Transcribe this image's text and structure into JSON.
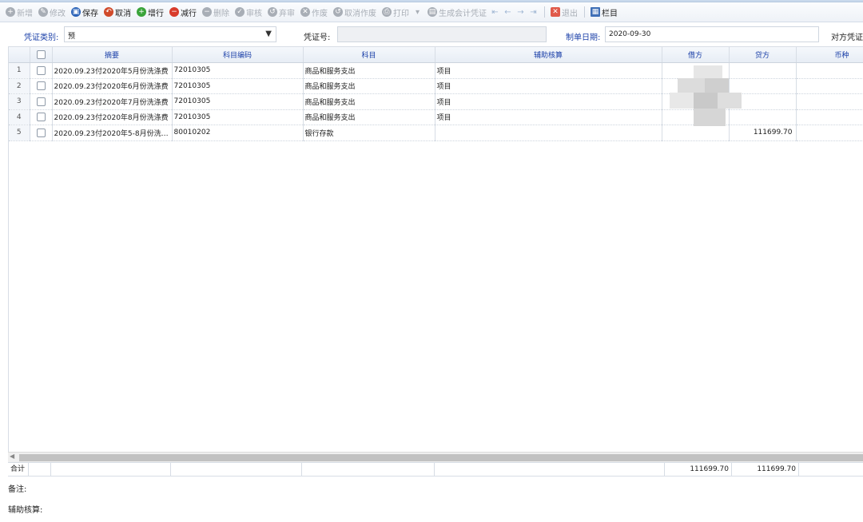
{
  "toolbar": {
    "items": [
      {
        "label": "新增",
        "icon": "plus-circle-icon",
        "color": "#a8aeb6",
        "disabled": true
      },
      {
        "label": "修改",
        "icon": "edit-icon",
        "color": "#a8aeb6",
        "disabled": true
      },
      {
        "label": "保存",
        "icon": "save-icon",
        "color": "#2b63b8",
        "disabled": false
      },
      {
        "label": "取消",
        "icon": "undo-icon",
        "color": "#d04a2a",
        "disabled": false
      },
      {
        "label": "增行",
        "icon": "add-row-icon",
        "color": "#3aa43a",
        "disabled": false
      },
      {
        "label": "减行",
        "icon": "remove-row-icon",
        "color": "#d83b2b",
        "disabled": false
      },
      {
        "label": "删除",
        "icon": "delete-icon",
        "color": "#a8aeb6",
        "disabled": true
      },
      {
        "label": "审核",
        "icon": "audit-icon",
        "color": "#a8aeb6",
        "disabled": true
      },
      {
        "label": "弃审",
        "icon": "unaudit-icon",
        "color": "#a8aeb6",
        "disabled": true
      },
      {
        "label": "作废",
        "icon": "void-icon",
        "color": "#a8aeb6",
        "disabled": true
      },
      {
        "label": "取消作废",
        "icon": "unvoid-icon",
        "color": "#a8aeb6",
        "disabled": true
      },
      {
        "label": "打印",
        "icon": "print-icon",
        "color": "#a8aeb6",
        "disabled": true
      },
      {
        "label": "生成会计凭证",
        "icon": "voucher-icon",
        "color": "#a8aeb6",
        "disabled": true
      }
    ],
    "nav": [
      "first-icon",
      "prev-icon",
      "next-icon",
      "last-icon"
    ],
    "exit_label": "退出",
    "columns_label": "栏目"
  },
  "form": {
    "voucher_type_label": "凭证类别:",
    "voucher_type_value": "预",
    "voucher_no_label": "凭证号:",
    "voucher_no_value": "",
    "date_label": "制单日期:",
    "date_value": "2020-09-30",
    "counterparty_label": "对方凭证号"
  },
  "grid": {
    "columns": [
      "",
      "摘要",
      "科目编码",
      "科目",
      "辅助核算",
      "借方",
      "贷方",
      "币种"
    ],
    "rows": [
      {
        "n": "1",
        "summary": "2020.09.23付2020年5月份洗涤费",
        "code": "72010305",
        "subject": "商品和服务支出",
        "aux": "项目",
        "debit": "",
        "credit": ""
      },
      {
        "n": "2",
        "summary": "2020.09.23付2020年6月份洗涤费",
        "code": "72010305",
        "subject": "商品和服务支出",
        "aux": "项目",
        "debit": "",
        "credit": ""
      },
      {
        "n": "3",
        "summary": "2020.09.23付2020年7月份洗涤费",
        "code": "72010305",
        "subject": "商品和服务支出",
        "aux": "项目",
        "debit": "",
        "credit": ""
      },
      {
        "n": "4",
        "summary": "2020.09.23付2020年8月份洗涤费",
        "code": "72010305",
        "subject": "商品和服务支出",
        "aux": "项目",
        "debit": "",
        "credit": ""
      },
      {
        "n": "5",
        "summary": "2020.09.23付2020年5-8月份洗…",
        "code": "80010202",
        "subject": "银行存款",
        "aux": "",
        "debit": "",
        "credit": "111699.70"
      }
    ]
  },
  "totals": {
    "label": "合计",
    "debit": "111699.70",
    "credit": "111699.70"
  },
  "footer": {
    "remark_label": "备注:",
    "aux_label": "辅助核算:"
  }
}
